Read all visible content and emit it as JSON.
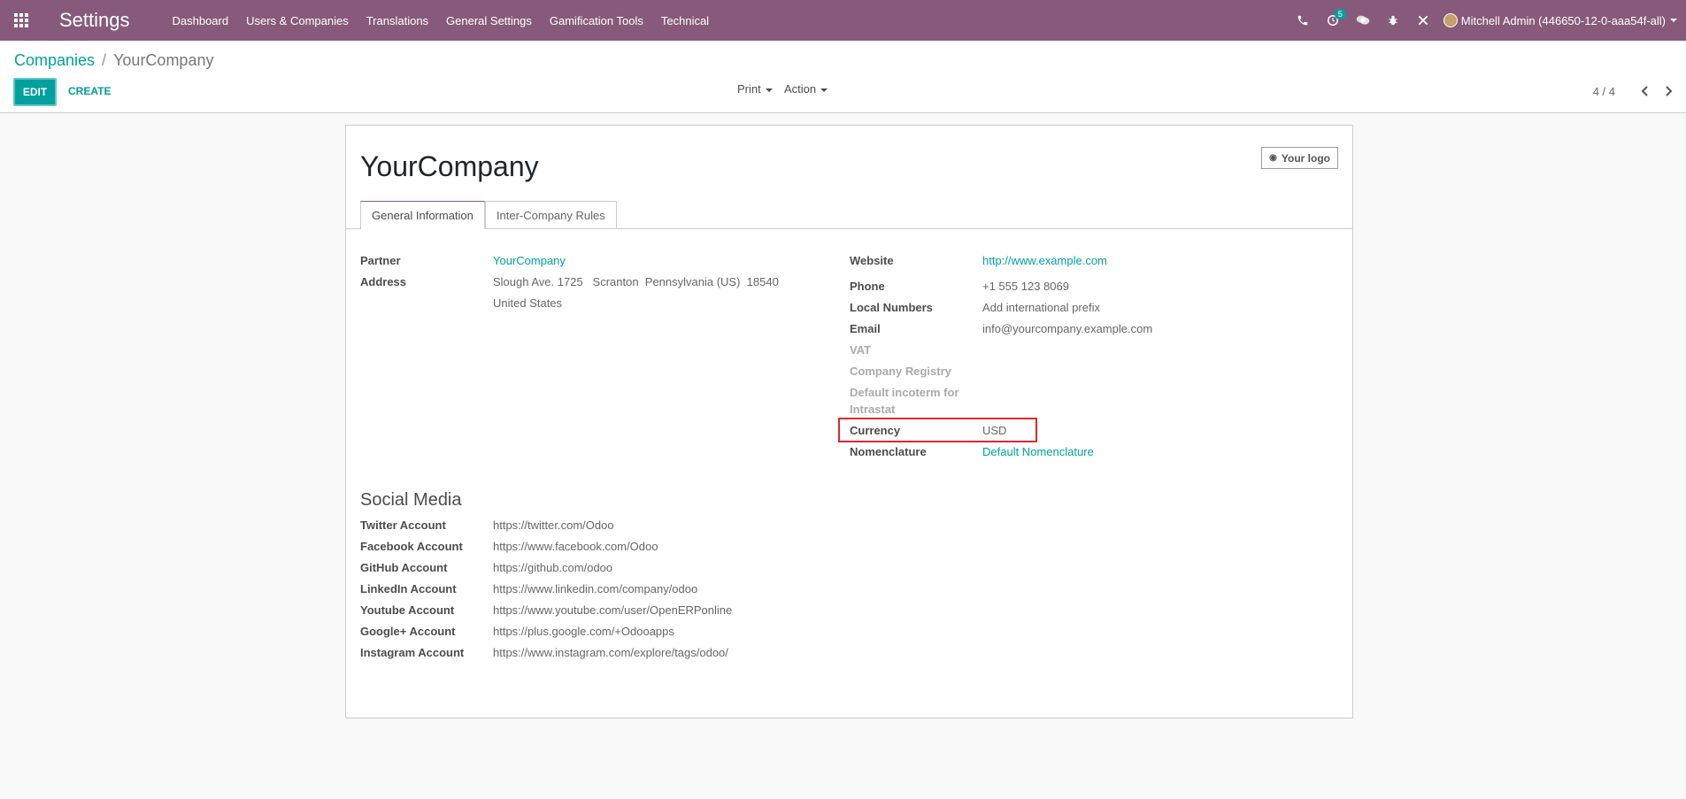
{
  "topbar": {
    "app_title": "Settings",
    "menu": [
      "Dashboard",
      "Users & Companies",
      "Translations",
      "General Settings",
      "Gamification Tools",
      "Technical"
    ],
    "activity_count": "5",
    "user_name": "Mitchell Admin (446650-12-0-aaa54f-all)"
  },
  "breadcrumb": {
    "parent": "Companies",
    "separator": "/",
    "current": "YourCompany"
  },
  "actions": {
    "edit": "EDIT",
    "create": "CREATE",
    "print": "Print",
    "action": "Action"
  },
  "pager": {
    "value": "4 / 4"
  },
  "form": {
    "company_name": "YourCompany",
    "logo_button": "Your logo",
    "tabs": [
      "General Information",
      "Inter-Company Rules"
    ],
    "left_fields": {
      "partner_label": "Partner",
      "partner_value": "YourCompany",
      "address_label": "Address",
      "address_line1": "Slough Ave. 1725   Scranton  Pennsylvania (US)  18540",
      "address_line2": "United States"
    },
    "right_fields": {
      "website_label": "Website",
      "website_value": "http://www.example.com",
      "phone_label": "Phone",
      "phone_value": "+1 555 123 8069",
      "local_numbers_label": "Local Numbers",
      "local_numbers_value": "Add international prefix",
      "email_label": "Email",
      "email_value": "info@yourcompany.example.com",
      "vat_label": "VAT",
      "registry_label": "Company Registry",
      "incoterm_label_1": "Default incoterm for",
      "incoterm_label_2": "Intrastat",
      "currency_label": "Currency",
      "currency_value": "USD",
      "nomenclature_label": "Nomenclature",
      "nomenclature_value": "Default Nomenclature"
    },
    "social": {
      "title": "Social Media",
      "rows": [
        {
          "label": "Twitter Account",
          "value": "https://twitter.com/Odoo"
        },
        {
          "label": "Facebook Account",
          "value": "https://www.facebook.com/Odoo"
        },
        {
          "label": "GitHub Account",
          "value": "https://github.com/odoo"
        },
        {
          "label": "LinkedIn Account",
          "value": "https://www.linkedin.com/company/odoo"
        },
        {
          "label": "Youtube Account",
          "value": "https://www.youtube.com/user/OpenERPonline"
        },
        {
          "label": "Google+ Account",
          "value": "https://plus.google.com/+Odooapps"
        },
        {
          "label": "Instagram Account",
          "value": "https://www.instagram.com/explore/tags/odoo/"
        }
      ]
    }
  }
}
